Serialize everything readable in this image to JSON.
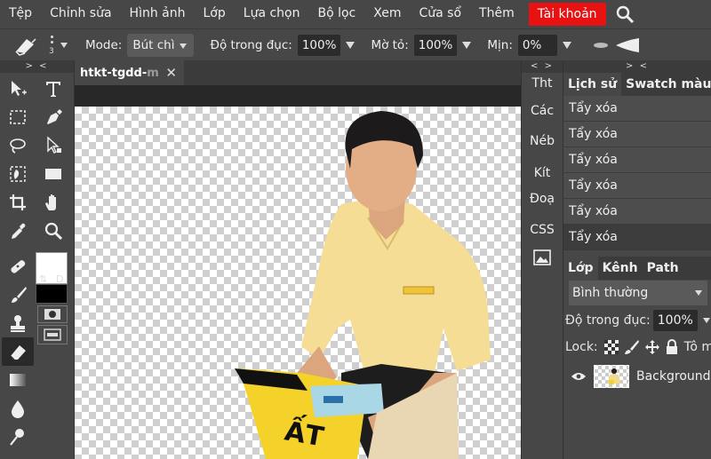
{
  "menu": {
    "items": [
      "Tệp",
      "Chỉnh sửa",
      "Hình ảnh",
      "Lớp",
      "Lựa chọn",
      "Bộ lọc",
      "Xem",
      "Cửa sổ",
      "Thêm"
    ],
    "account": "Tài khoản",
    "account_color": "#e81212"
  },
  "options": {
    "brush_size": "3",
    "mode_label": "Mode:",
    "mode_value": "Bút chì",
    "opacity_label": "Độ trong đục:",
    "opacity_value": "100%",
    "flow_label": "Mờ tỏ:",
    "flow_value": "100%",
    "smooth_label": "Mịn:",
    "smooth_value": "0%"
  },
  "tools": {
    "collapse": "> <",
    "swap": "⇅",
    "default": "D"
  },
  "document": {
    "tab_title": "htkt-tgdd-",
    "tab_title_faded": "m",
    "close": "✕"
  },
  "mini_panel": {
    "collapse": "< >",
    "items": [
      "Tht",
      "Các",
      "Néb",
      "Kít",
      "Đoạ",
      "CSS"
    ]
  },
  "history_panel": {
    "collapse": "> <",
    "tabs": [
      "Lịch sử",
      "Swatch màu"
    ],
    "items": [
      "Tẩy xóa",
      "Tẩy xóa",
      "Tẩy xóa",
      "Tẩy xóa",
      "Tẩy xóa",
      "Tẩy xóa"
    ]
  },
  "layers_panel": {
    "tabs": [
      "Lớp",
      "Kênh",
      "Path"
    ],
    "blend_mode": "Bình thường",
    "opacity_label": "Độ trong đục:",
    "opacity_value": "100%",
    "lock_label": "Lock:",
    "lock_extra": "Tô m",
    "layer_name": "Background"
  }
}
